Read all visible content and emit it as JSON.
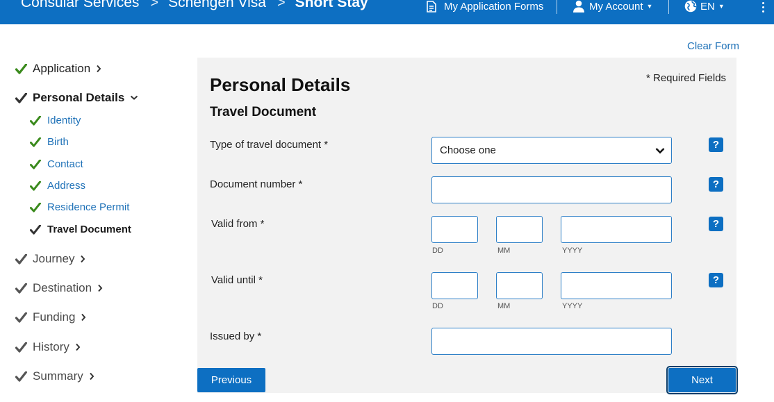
{
  "header": {
    "breadcrumbs": [
      "Consular Services",
      "Schengen Visa",
      "Short Stay"
    ],
    "separator": ">",
    "nav": {
      "application_forms": "My Application Forms",
      "account": "My Account",
      "language": "EN"
    },
    "colors": {
      "brand": "#0d6fc2"
    },
    "icons": [
      "forms-icon",
      "user-icon",
      "globe-icon",
      "kebab-menu-icon"
    ]
  },
  "sidebar": {
    "items": [
      {
        "label": "Application",
        "state": "complete"
      },
      {
        "label": "Personal Details",
        "state": "active"
      },
      {
        "label": "Journey",
        "state": "pending"
      },
      {
        "label": "Destination",
        "state": "pending"
      },
      {
        "label": "Funding",
        "state": "pending"
      },
      {
        "label": "History",
        "state": "pending"
      },
      {
        "label": "Summary",
        "state": "pending"
      }
    ],
    "subitems": [
      {
        "label": "Identity",
        "state": "complete"
      },
      {
        "label": "Birth",
        "state": "complete"
      },
      {
        "label": "Contact",
        "state": "complete"
      },
      {
        "label": "Address",
        "state": "complete"
      },
      {
        "label": "Residence Permit",
        "state": "complete"
      },
      {
        "label": "Travel Document",
        "state": "current"
      }
    ],
    "colors": {
      "check_complete": "#3a8a1c",
      "check_pending": "#555555",
      "link": "#1f72b8"
    }
  },
  "main": {
    "clear_form": "Clear Form",
    "title": "Personal Details",
    "required_note": "* Required Fields",
    "section": "Travel Document",
    "fields": {
      "doc_type": {
        "label": "Type of travel document *",
        "value": "Choose one"
      },
      "doc_number": {
        "label": "Document number *",
        "value": ""
      },
      "valid_from": {
        "label": "Valid from *",
        "dd": "DD",
        "mm": "MM",
        "yyyy": "YYYY"
      },
      "valid_until": {
        "label": "Valid until *",
        "dd": "DD",
        "mm": "MM",
        "yyyy": "YYYY"
      },
      "issued_by": {
        "label": "Issued by *",
        "value": ""
      }
    },
    "help_label": "?",
    "buttons": {
      "previous": "Previous",
      "next": "Next"
    }
  }
}
